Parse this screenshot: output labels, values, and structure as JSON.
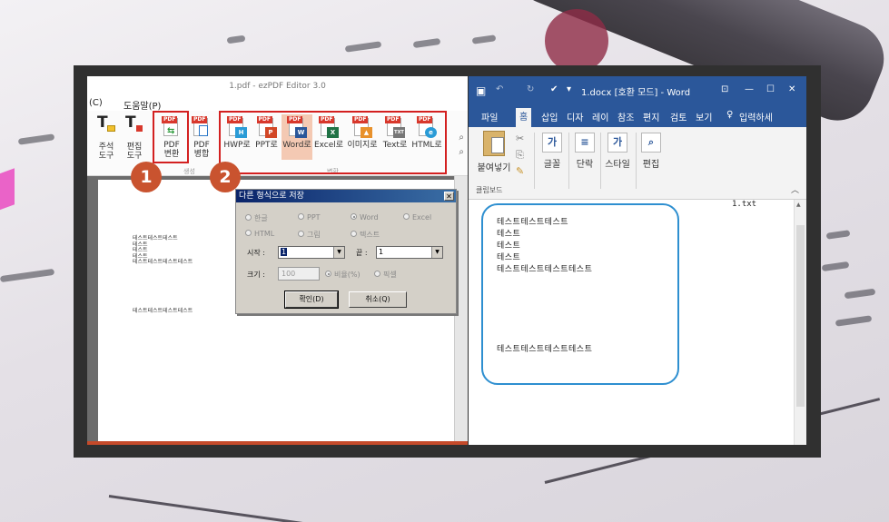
{
  "ezpdf": {
    "title": "1.pdf - ezPDF Editor 3.0",
    "menu_left": "(C)",
    "menu_help": "도움말(P)",
    "tools": {
      "annot": "주석\n도구",
      "edit": "편집\n도구",
      "pdf_convert": "PDF\n변환",
      "pdf_merge": "PDF\n병합",
      "group_label": "생성",
      "convert_group_label": "변환"
    },
    "convert_buttons": [
      "HWP로",
      "PPT로",
      "Word로",
      "Excel로",
      "이미지로",
      "Text로",
      "HTML로"
    ],
    "steps": [
      "1",
      "2"
    ],
    "page_lines_top": [
      "테스트테스트테스트",
      "테스트",
      "테스트",
      "테스트",
      "테스트테스트테스트테스트"
    ],
    "page_line_bottom": "테스트테스트테스트테스트",
    "dialog": {
      "title": "다른 형식으로 저장",
      "formats_row1": [
        "한글",
        "PPT",
        "Word",
        "Excel"
      ],
      "formats_row2": [
        "HTML",
        "그림",
        "텍스트"
      ],
      "start_label": "시작 :",
      "start_value": "1",
      "end_label": "끝 :",
      "end_value": "1",
      "size_label": "크기 :",
      "size_value": "100",
      "ratio_label": "비율(%)",
      "pixel_label": "픽셀",
      "ok": "확인(D)",
      "cancel": "취소(Q)"
    },
    "colors": {
      "badge": "#c9532f",
      "highlight": "#d32020"
    }
  },
  "word": {
    "title": "1.docx [호환 모드] - Word",
    "tabs": [
      "파일",
      "홈",
      "삽입",
      "디자",
      "레이",
      "참조",
      "편지",
      "검토",
      "보기"
    ],
    "tell_me": "입력하세",
    "ribbon": {
      "paste": "붙여넣기",
      "font": "글꼴",
      "paragraph": "단락",
      "style": "스타일",
      "edit": "편집",
      "clipboard": "클립보드"
    },
    "file_label": "1.txt",
    "doc_lines_top": [
      "테스트테스트테스트",
      "테스트",
      "테스트",
      "테스트",
      "테스트테스트테스트테스트"
    ],
    "doc_line_bottom": "테스트테스트테스트테스트",
    "colors": {
      "titlebar": "#2b579a",
      "bubble": "#2e8fd0"
    }
  }
}
